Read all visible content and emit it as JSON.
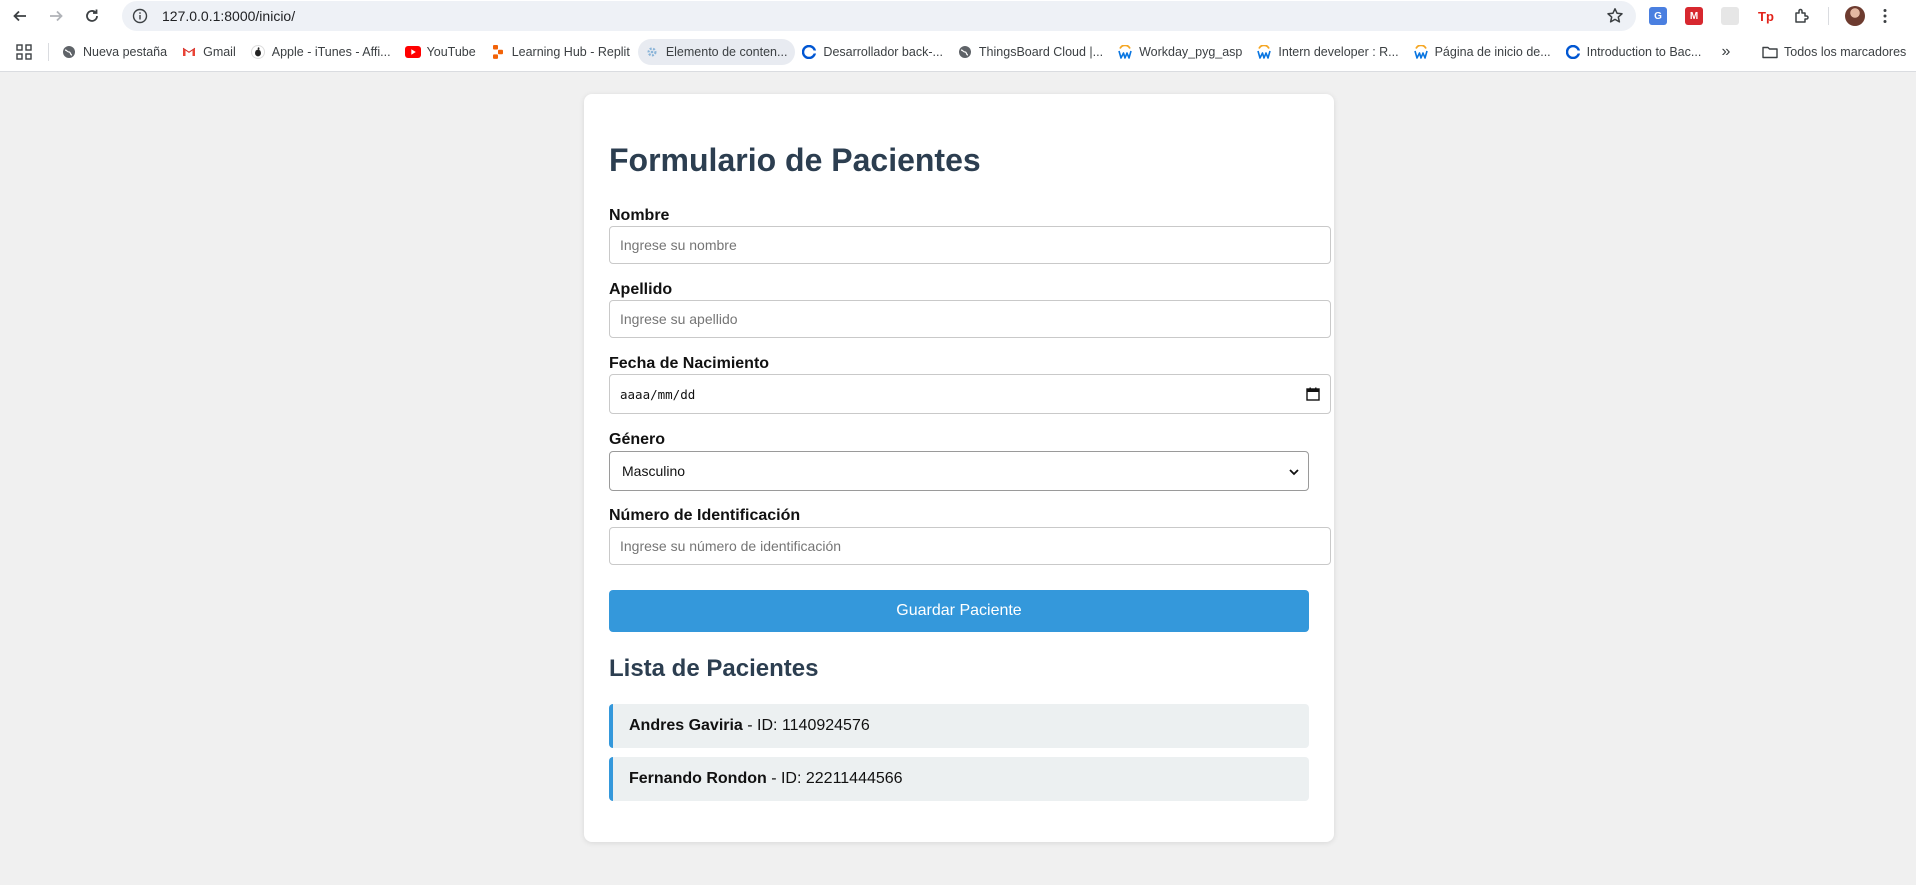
{
  "browser": {
    "url": "127.0.0.1:8000/inicio/",
    "bookmarks": [
      {
        "label": "Nueva pestaña",
        "icon": "globe-icon"
      },
      {
        "label": "Gmail",
        "icon": "gmail-icon"
      },
      {
        "label": "Apple - iTunes - Affi...",
        "icon": "apple-icon"
      },
      {
        "label": "YouTube",
        "icon": "youtube-icon"
      },
      {
        "label": "Learning Hub - Replit",
        "icon": "replit-icon"
      },
      {
        "label": "Elemento de conten...",
        "icon": "gear-icon"
      },
      {
        "label": "Desarrollador back-...",
        "icon": "coursera-icon"
      },
      {
        "label": "ThingsBoard Cloud |...",
        "icon": "globe-icon"
      },
      {
        "label": "Workday_pyg_asp",
        "icon": "workday-icon"
      },
      {
        "label": "Intern developer : R...",
        "icon": "workday-icon"
      },
      {
        "label": "Página de inicio de...",
        "icon": "workday-icon"
      },
      {
        "label": "Introduction to Bac...",
        "icon": "coursera-icon"
      }
    ],
    "all_bookmarks_label": "Todos los marcadores",
    "more_label": "»"
  },
  "form": {
    "title": "Formulario de Pacientes",
    "nombre_label": "Nombre",
    "nombre_placeholder": "Ingrese su nombre",
    "apellido_label": "Apellido",
    "apellido_placeholder": "Ingrese su apellido",
    "fecha_label": "Fecha de Nacimiento",
    "fecha_value": "aaaa/mm/dd",
    "genero_label": "Género",
    "genero_value": "Masculino",
    "id_label": "Número de Identificación",
    "id_placeholder": "Ingrese su número de identificación",
    "save_label": "Guardar Paciente"
  },
  "list": {
    "title": "Lista de Pacientes",
    "patients": [
      {
        "name": "Andres Gaviria",
        "id_text": " - ID: 1140924576"
      },
      {
        "name": "Fernando Rondon",
        "id_text": " - ID: 22211444566"
      }
    ]
  },
  "colors": {
    "primary": "#3498db",
    "heading": "#2c3e50",
    "list_bg": "#ecf0f1",
    "page_bg": "#f0f0f0"
  }
}
